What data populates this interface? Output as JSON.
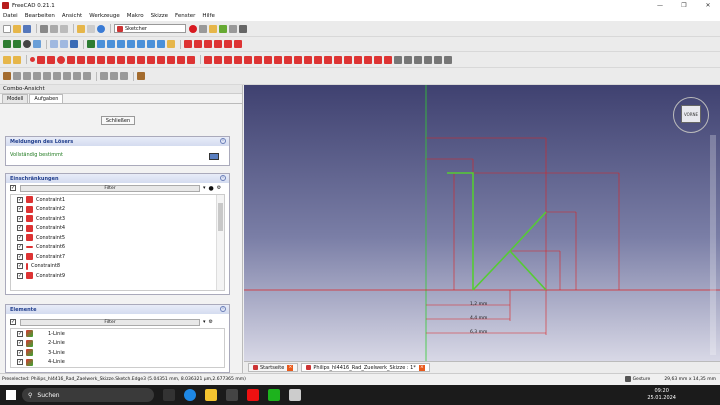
{
  "window": {
    "title": "FreeCAD 0.21.1"
  },
  "menu": [
    "Datei",
    "Bearbeiten",
    "Ansicht",
    "Werkzeuge",
    "Makro",
    "Skizze",
    "Fenster",
    "Hilfe"
  ],
  "toolbar": {
    "workbench": "Sketcher"
  },
  "left_panel": {
    "title": "Combo-Ansicht",
    "tabs": [
      "Modell",
      "Aufgaben"
    ],
    "close_button": "Schließen",
    "solver": {
      "title": "Meldungen des Lösers",
      "status": "Vollständig bestimmt"
    },
    "constraints": {
      "title": "Einschränkungen",
      "filter": "Filter",
      "items": [
        "Constraint1",
        "Constraint2",
        "Constraint3",
        "Constraint4",
        "Constraint5",
        "Constraint6",
        "Constraint7",
        "Constraint8",
        "Constraint9"
      ]
    },
    "elements": {
      "title": "Elemente",
      "filter": "Filter",
      "items": [
        "1-Linie",
        "2-Linie",
        "3-Linie",
        "4-Linie"
      ]
    }
  },
  "view": {
    "navcube_label": "VORNE",
    "dimensions": [
      "1,2 mm",
      "4,4 mm",
      "6,3 mm"
    ],
    "tabs": [
      "Startseite",
      "Philips_hl4416_Rad_Zuelwerk_Skizze : 1*"
    ]
  },
  "status": {
    "message": "Preselected: Philips_hl4416_Rad_Zaelwerk_Skizze.Sketch.Edge3 (5.04351 mm, 8.036321 µm,2.677365 mm)",
    "nav_style": "Gesture",
    "size": "29,63 mm x 14,35 mm"
  },
  "taskbar": {
    "search": "Suchen",
    "time": "09:20",
    "date": "25.01.2024"
  },
  "colors": {
    "view_top": "#3f4170",
    "view_bottom": "#d8d8e6",
    "sketch_line": "#55cc33",
    "dimension": "#dd2222",
    "accent": "#23408e"
  }
}
